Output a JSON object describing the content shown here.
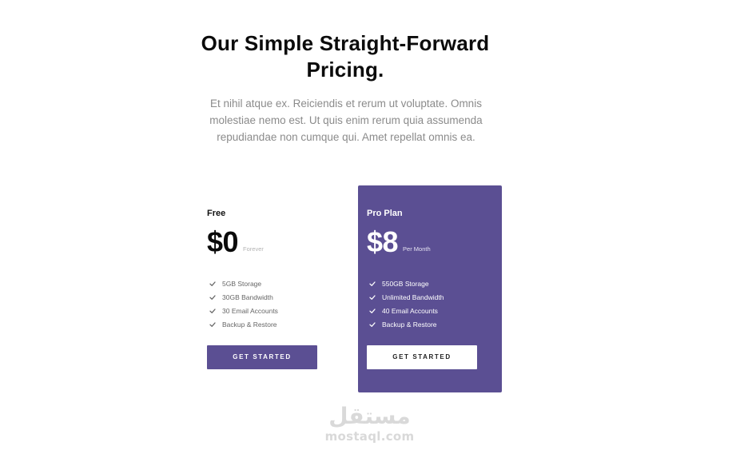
{
  "header": {
    "title": "Our Simple Straight-Forward Pricing.",
    "subtitle": "Et nihil atque ex. Reiciendis et rerum ut voluptate. Omnis molestiae nemo est. Ut quis enim rerum quia assumenda repudiandae non cumque qui. Amet repellat omnis ea."
  },
  "plans": [
    {
      "name": "Free",
      "price": "$0",
      "period": "Forever",
      "features": [
        "5GB Storage",
        "30GB Bandwidth",
        "30 Email Accounts",
        "Backup & Restore"
      ],
      "cta": "GET STARTED",
      "feature_icon": "check-icon"
    },
    {
      "name": "Pro Plan",
      "price": "$8",
      "period": "Per Month",
      "features": [
        "550GB Storage",
        "Unlimited Bandwidth",
        "40 Email Accounts",
        "Backup & Restore"
      ],
      "cta": "GET STARTED",
      "feature_icon": "check-icon"
    }
  ],
  "colors": {
    "accent": "#5b4f93",
    "heading": "#0b0b0b",
    "muted_text": "#8b8b8b",
    "background": "#ffffff"
  },
  "watermark": {
    "arabic": "مستقل",
    "latin": "mostaql.com"
  }
}
